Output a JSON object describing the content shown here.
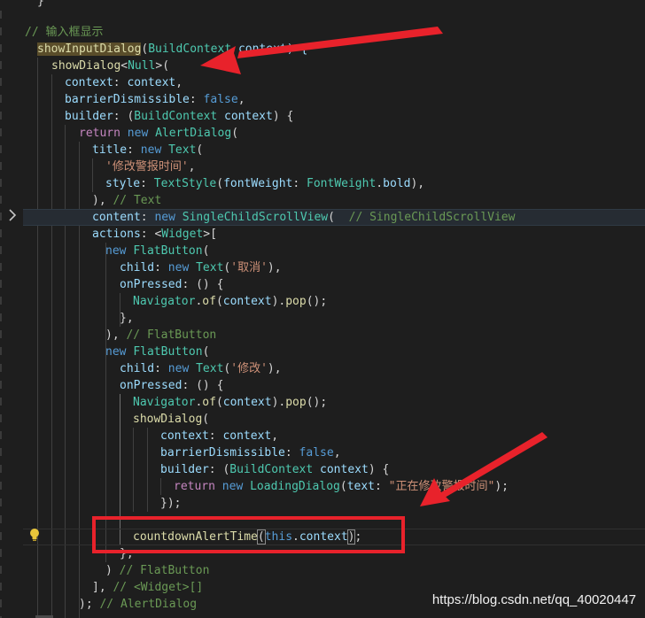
{
  "editor": {
    "lines": [
      {
        "name": "code-line-closing-brace",
        "tokens": [
          {
            "t": "}",
            "c": "plain"
          }
        ]
      },
      {
        "name": "code-line-comment",
        "tokens": [
          {
            "t": "// 输入框显示",
            "c": "comment"
          }
        ]
      },
      {
        "name": "code-line-function-declaration",
        "tokens": [
          {
            "t": "showInputDialog",
            "c": "fnhl"
          },
          {
            "t": "(",
            "c": "plain"
          },
          {
            "t": "BuildContext",
            "c": "type"
          },
          {
            "t": " context) {",
            "c": "param"
          }
        ]
      },
      {
        "name": "code-line-show-dialog",
        "tokens": [
          {
            "t": "showDialog",
            "c": "fn"
          },
          {
            "t": "<",
            "c": "plain"
          },
          {
            "t": "Null",
            "c": "type"
          },
          {
            "t": ">(",
            "c": "plain"
          }
        ]
      },
      {
        "name": "code-line-context-arg",
        "tokens": [
          {
            "t": "context",
            "c": "param"
          },
          {
            "t": ": ",
            "c": "plain"
          },
          {
            "t": "context",
            "c": "param"
          },
          {
            "t": ",",
            "c": "plain"
          }
        ]
      },
      {
        "name": "code-line-barrier-dismissible",
        "tokens": [
          {
            "t": "barrierDismissible",
            "c": "param"
          },
          {
            "t": ": ",
            "c": "plain"
          },
          {
            "t": "false",
            "c": "kw"
          },
          {
            "t": ",",
            "c": "plain"
          }
        ]
      },
      {
        "name": "code-line-builder",
        "tokens": [
          {
            "t": "builder",
            "c": "param"
          },
          {
            "t": ": (",
            "c": "plain"
          },
          {
            "t": "BuildContext",
            "c": "type"
          },
          {
            "t": " ",
            "c": "plain"
          },
          {
            "t": "context",
            "c": "param"
          },
          {
            "t": ") {",
            "c": "plain"
          }
        ]
      },
      {
        "name": "code-line-return-alert-dialog",
        "tokens": [
          {
            "t": "return",
            "c": "ctl"
          },
          {
            "t": " ",
            "c": "plain"
          },
          {
            "t": "new",
            "c": "kw"
          },
          {
            "t": " ",
            "c": "plain"
          },
          {
            "t": "AlertDialog",
            "c": "type"
          },
          {
            "t": "(",
            "c": "plain"
          }
        ]
      },
      {
        "name": "code-line-title",
        "tokens": [
          {
            "t": "title",
            "c": "param"
          },
          {
            "t": ": ",
            "c": "plain"
          },
          {
            "t": "new",
            "c": "kw"
          },
          {
            "t": " ",
            "c": "plain"
          },
          {
            "t": "Text",
            "c": "type"
          },
          {
            "t": "(",
            "c": "plain"
          }
        ]
      },
      {
        "name": "code-line-title-string",
        "tokens": [
          {
            "t": "'修改警报时间'",
            "c": "str"
          },
          {
            "t": ",",
            "c": "plain"
          }
        ]
      },
      {
        "name": "code-line-style",
        "tokens": [
          {
            "t": "style",
            "c": "param"
          },
          {
            "t": ": ",
            "c": "plain"
          },
          {
            "t": "TextStyle",
            "c": "type"
          },
          {
            "t": "(",
            "c": "plain"
          },
          {
            "t": "fontWeight",
            "c": "param"
          },
          {
            "t": ": ",
            "c": "plain"
          },
          {
            "t": "FontWeight",
            "c": "type"
          },
          {
            "t": ".",
            "c": "plain"
          },
          {
            "t": "bold",
            "c": "param"
          },
          {
            "t": "),",
            "c": "plain"
          }
        ]
      },
      {
        "name": "code-line-text-close",
        "tokens": [
          {
            "t": "), ",
            "c": "plain"
          },
          {
            "t": "// Text",
            "c": "comment"
          }
        ]
      },
      {
        "name": "code-line-content",
        "tokens": [
          {
            "t": "content",
            "c": "param"
          },
          {
            "t": ": ",
            "c": "plain"
          },
          {
            "t": "new",
            "c": "kw"
          },
          {
            "t": " ",
            "c": "plain"
          },
          {
            "t": "SingleChildScrollView",
            "c": "type"
          },
          {
            "t": "(  ",
            "c": "plain"
          },
          {
            "t": "// SingleChildScrollView",
            "c": "comment"
          }
        ]
      },
      {
        "name": "code-line-actions",
        "tokens": [
          {
            "t": "actions",
            "c": "param"
          },
          {
            "t": ": <",
            "c": "plain"
          },
          {
            "t": "Widget",
            "c": "type"
          },
          {
            "t": ">[",
            "c": "plain"
          }
        ]
      },
      {
        "name": "code-line-flat-button-1",
        "tokens": [
          {
            "t": "new",
            "c": "kw"
          },
          {
            "t": " ",
            "c": "plain"
          },
          {
            "t": "FlatButton",
            "c": "type"
          },
          {
            "t": "(",
            "c": "plain"
          }
        ]
      },
      {
        "name": "code-line-child-cancel",
        "tokens": [
          {
            "t": "child",
            "c": "param"
          },
          {
            "t": ": ",
            "c": "plain"
          },
          {
            "t": "new",
            "c": "kw"
          },
          {
            "t": " ",
            "c": "plain"
          },
          {
            "t": "Text",
            "c": "type"
          },
          {
            "t": "(",
            "c": "plain"
          },
          {
            "t": "'取消'",
            "c": "str"
          },
          {
            "t": "),",
            "c": "plain"
          }
        ]
      },
      {
        "name": "code-line-on-pressed-1",
        "tokens": [
          {
            "t": "onPressed",
            "c": "param"
          },
          {
            "t": ": () {",
            "c": "plain"
          }
        ]
      },
      {
        "name": "code-line-navigator-pop-1",
        "tokens": [
          {
            "t": "Navigator",
            "c": "type"
          },
          {
            "t": ".",
            "c": "plain"
          },
          {
            "t": "of",
            "c": "fn"
          },
          {
            "t": "(",
            "c": "plain"
          },
          {
            "t": "context",
            "c": "param"
          },
          {
            "t": ").",
            "c": "plain"
          },
          {
            "t": "pop",
            "c": "fn"
          },
          {
            "t": "();",
            "c": "plain"
          }
        ]
      },
      {
        "name": "code-line-close-brace-1",
        "tokens": [
          {
            "t": "},",
            "c": "plain"
          }
        ]
      },
      {
        "name": "code-line-flat-button-close-1",
        "tokens": [
          {
            "t": "), ",
            "c": "plain"
          },
          {
            "t": "// FlatButton",
            "c": "comment"
          }
        ]
      },
      {
        "name": "code-line-flat-button-2",
        "tokens": [
          {
            "t": "new",
            "c": "kw"
          },
          {
            "t": " ",
            "c": "plain"
          },
          {
            "t": "FlatButton",
            "c": "type"
          },
          {
            "t": "(",
            "c": "plain"
          }
        ]
      },
      {
        "name": "code-line-child-modify",
        "tokens": [
          {
            "t": "child",
            "c": "param"
          },
          {
            "t": ": ",
            "c": "plain"
          },
          {
            "t": "new",
            "c": "kw"
          },
          {
            "t": " ",
            "c": "plain"
          },
          {
            "t": "Text",
            "c": "type"
          },
          {
            "t": "(",
            "c": "plain"
          },
          {
            "t": "'修改'",
            "c": "str"
          },
          {
            "t": "),",
            "c": "plain"
          }
        ]
      },
      {
        "name": "code-line-on-pressed-2",
        "tokens": [
          {
            "t": "onPressed",
            "c": "param"
          },
          {
            "t": ": () {",
            "c": "plain"
          }
        ]
      },
      {
        "name": "code-line-navigator-pop-2",
        "tokens": [
          {
            "t": "Navigator",
            "c": "type"
          },
          {
            "t": ".",
            "c": "plain"
          },
          {
            "t": "of",
            "c": "fn"
          },
          {
            "t": "(",
            "c": "plain"
          },
          {
            "t": "context",
            "c": "param"
          },
          {
            "t": ").",
            "c": "plain"
          },
          {
            "t": "pop",
            "c": "fn"
          },
          {
            "t": "();",
            "c": "plain"
          }
        ]
      },
      {
        "name": "code-line-show-dialog-2",
        "tokens": [
          {
            "t": "showDialog",
            "c": "fn"
          },
          {
            "t": "(",
            "c": "plain"
          }
        ]
      },
      {
        "name": "code-line-context-arg-2",
        "tokens": [
          {
            "t": "context",
            "c": "param"
          },
          {
            "t": ": ",
            "c": "plain"
          },
          {
            "t": "context",
            "c": "param"
          },
          {
            "t": ",",
            "c": "plain"
          }
        ]
      },
      {
        "name": "code-line-barrier-dismissible-2",
        "tokens": [
          {
            "t": "barrierDismissible",
            "c": "param"
          },
          {
            "t": ": ",
            "c": "plain"
          },
          {
            "t": "false",
            "c": "kw"
          },
          {
            "t": ",",
            "c": "plain"
          }
        ]
      },
      {
        "name": "code-line-builder-2",
        "tokens": [
          {
            "t": "builder",
            "c": "param"
          },
          {
            "t": ": (",
            "c": "plain"
          },
          {
            "t": "BuildContext",
            "c": "type"
          },
          {
            "t": " ",
            "c": "plain"
          },
          {
            "t": "context",
            "c": "param"
          },
          {
            "t": ") {",
            "c": "plain"
          }
        ]
      },
      {
        "name": "code-line-return-loading-dialog",
        "tokens": [
          {
            "t": "return",
            "c": "ctl"
          },
          {
            "t": " ",
            "c": "plain"
          },
          {
            "t": "new",
            "c": "kw"
          },
          {
            "t": " ",
            "c": "plain"
          },
          {
            "t": "LoadingDialog",
            "c": "type"
          },
          {
            "t": "(",
            "c": "plain"
          },
          {
            "t": "text",
            "c": "param"
          },
          {
            "t": ": ",
            "c": "plain"
          },
          {
            "t": "\"正在修改警报时间\"",
            "c": "str"
          },
          {
            "t": ");",
            "c": "plain"
          }
        ]
      },
      {
        "name": "code-line-builder-close",
        "tokens": [
          {
            "t": "});",
            "c": "plain"
          }
        ]
      },
      {
        "name": "code-line-blank",
        "tokens": []
      },
      {
        "name": "code-line-countdown-call",
        "tokens": [
          {
            "t": "countdownAlertTime",
            "c": "fn"
          },
          {
            "t": "(",
            "c": "bracket"
          },
          {
            "t": "this",
            "c": "kw"
          },
          {
            "t": ".",
            "c": "plain"
          },
          {
            "t": "context",
            "c": "param"
          },
          {
            "t": ")",
            "c": "bracket"
          },
          {
            "t": ";",
            "c": "plain"
          }
        ]
      },
      {
        "name": "code-line-close-brace-2",
        "tokens": [
          {
            "t": "},",
            "c": "plain"
          }
        ]
      },
      {
        "name": "code-line-flat-button-close-2",
        "tokens": [
          {
            "t": ") ",
            "c": "plain"
          },
          {
            "t": "// FlatButton",
            "c": "comment"
          }
        ]
      },
      {
        "name": "code-line-actions-close",
        "tokens": [
          {
            "t": "], ",
            "c": "plain"
          },
          {
            "t": "// <Widget>[]",
            "c": "comment"
          }
        ]
      },
      {
        "name": "code-line-alert-dialog-close",
        "tokens": [
          {
            "t": "); ",
            "c": "plain"
          },
          {
            "t": "// AlertDialog",
            "c": "comment"
          }
        ]
      }
    ],
    "watermark": "https://blog.csdn.net/qq_40020447"
  },
  "colors": {
    "background": "#1e1e1e",
    "comment": "#6a9955",
    "function": "#dcdcaa",
    "type": "#4ec9b0",
    "keyword": "#569cd6",
    "control": "#c586c0",
    "string": "#ce9178",
    "parameter": "#9cdcfe",
    "plain": "#d4d4d4",
    "annotation_red": "#e8222b"
  },
  "icons": {
    "fold": "chevron-right-icon",
    "lightbulb": "lightbulb-icon"
  }
}
